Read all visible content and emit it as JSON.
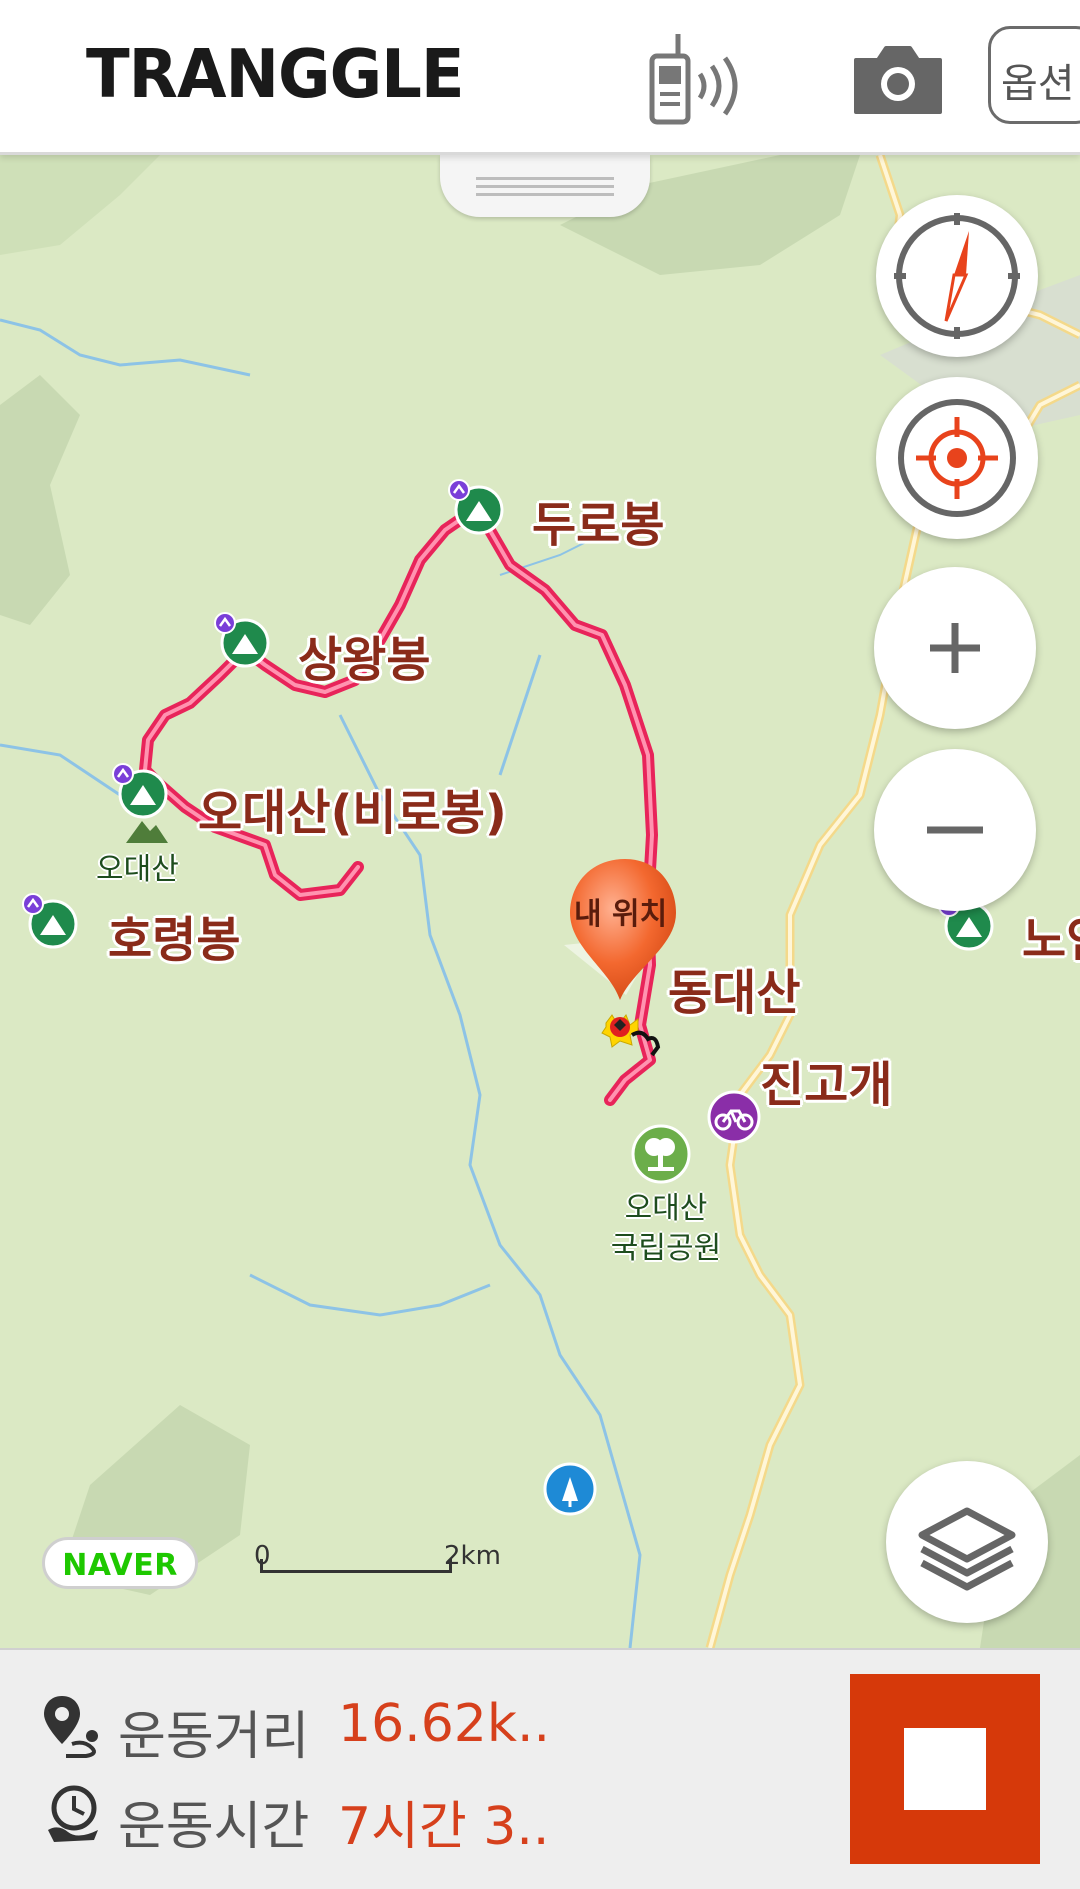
{
  "header": {
    "logo": "TRANGGLE",
    "options_label": "옵션"
  },
  "icons": {
    "radio": "walkie-talkie-icon",
    "camera": "camera-icon",
    "compass": "compass-icon",
    "locate": "target-icon",
    "zoom_in": "plus-icon",
    "zoom_out": "minus-icon",
    "layers": "layers-icon",
    "distance": "route-pin-icon",
    "time": "clock-icon"
  },
  "map": {
    "peaks": {
      "duro": "두로봉",
      "sangwang": "상왕봉",
      "odae_birobong": "오대산(비로봉)",
      "horyeong": "호령봉",
      "no": "노인"
    },
    "places": {
      "dongdaesan": "동대산",
      "jingogae": "진고개",
      "odaesan_mountain": "오대산",
      "national_park_line1": "오대산",
      "national_park_line2": "국립공원"
    },
    "my_location": "내 위치",
    "naver_badge": "NAVER",
    "scale": {
      "zero": "0",
      "max": "2km"
    }
  },
  "stats": {
    "distance_label": "운동거리",
    "distance_value": "16.62k..",
    "time_label": "운동시간",
    "time_value": "7시간 3.."
  },
  "colors": {
    "route": "#e8245a",
    "peak_green": "#1f8a4c",
    "label_brown": "#8a2b1a",
    "stat_value": "#d6401c",
    "stop": "#d6390a",
    "map_bg": "#dbe9c4"
  }
}
